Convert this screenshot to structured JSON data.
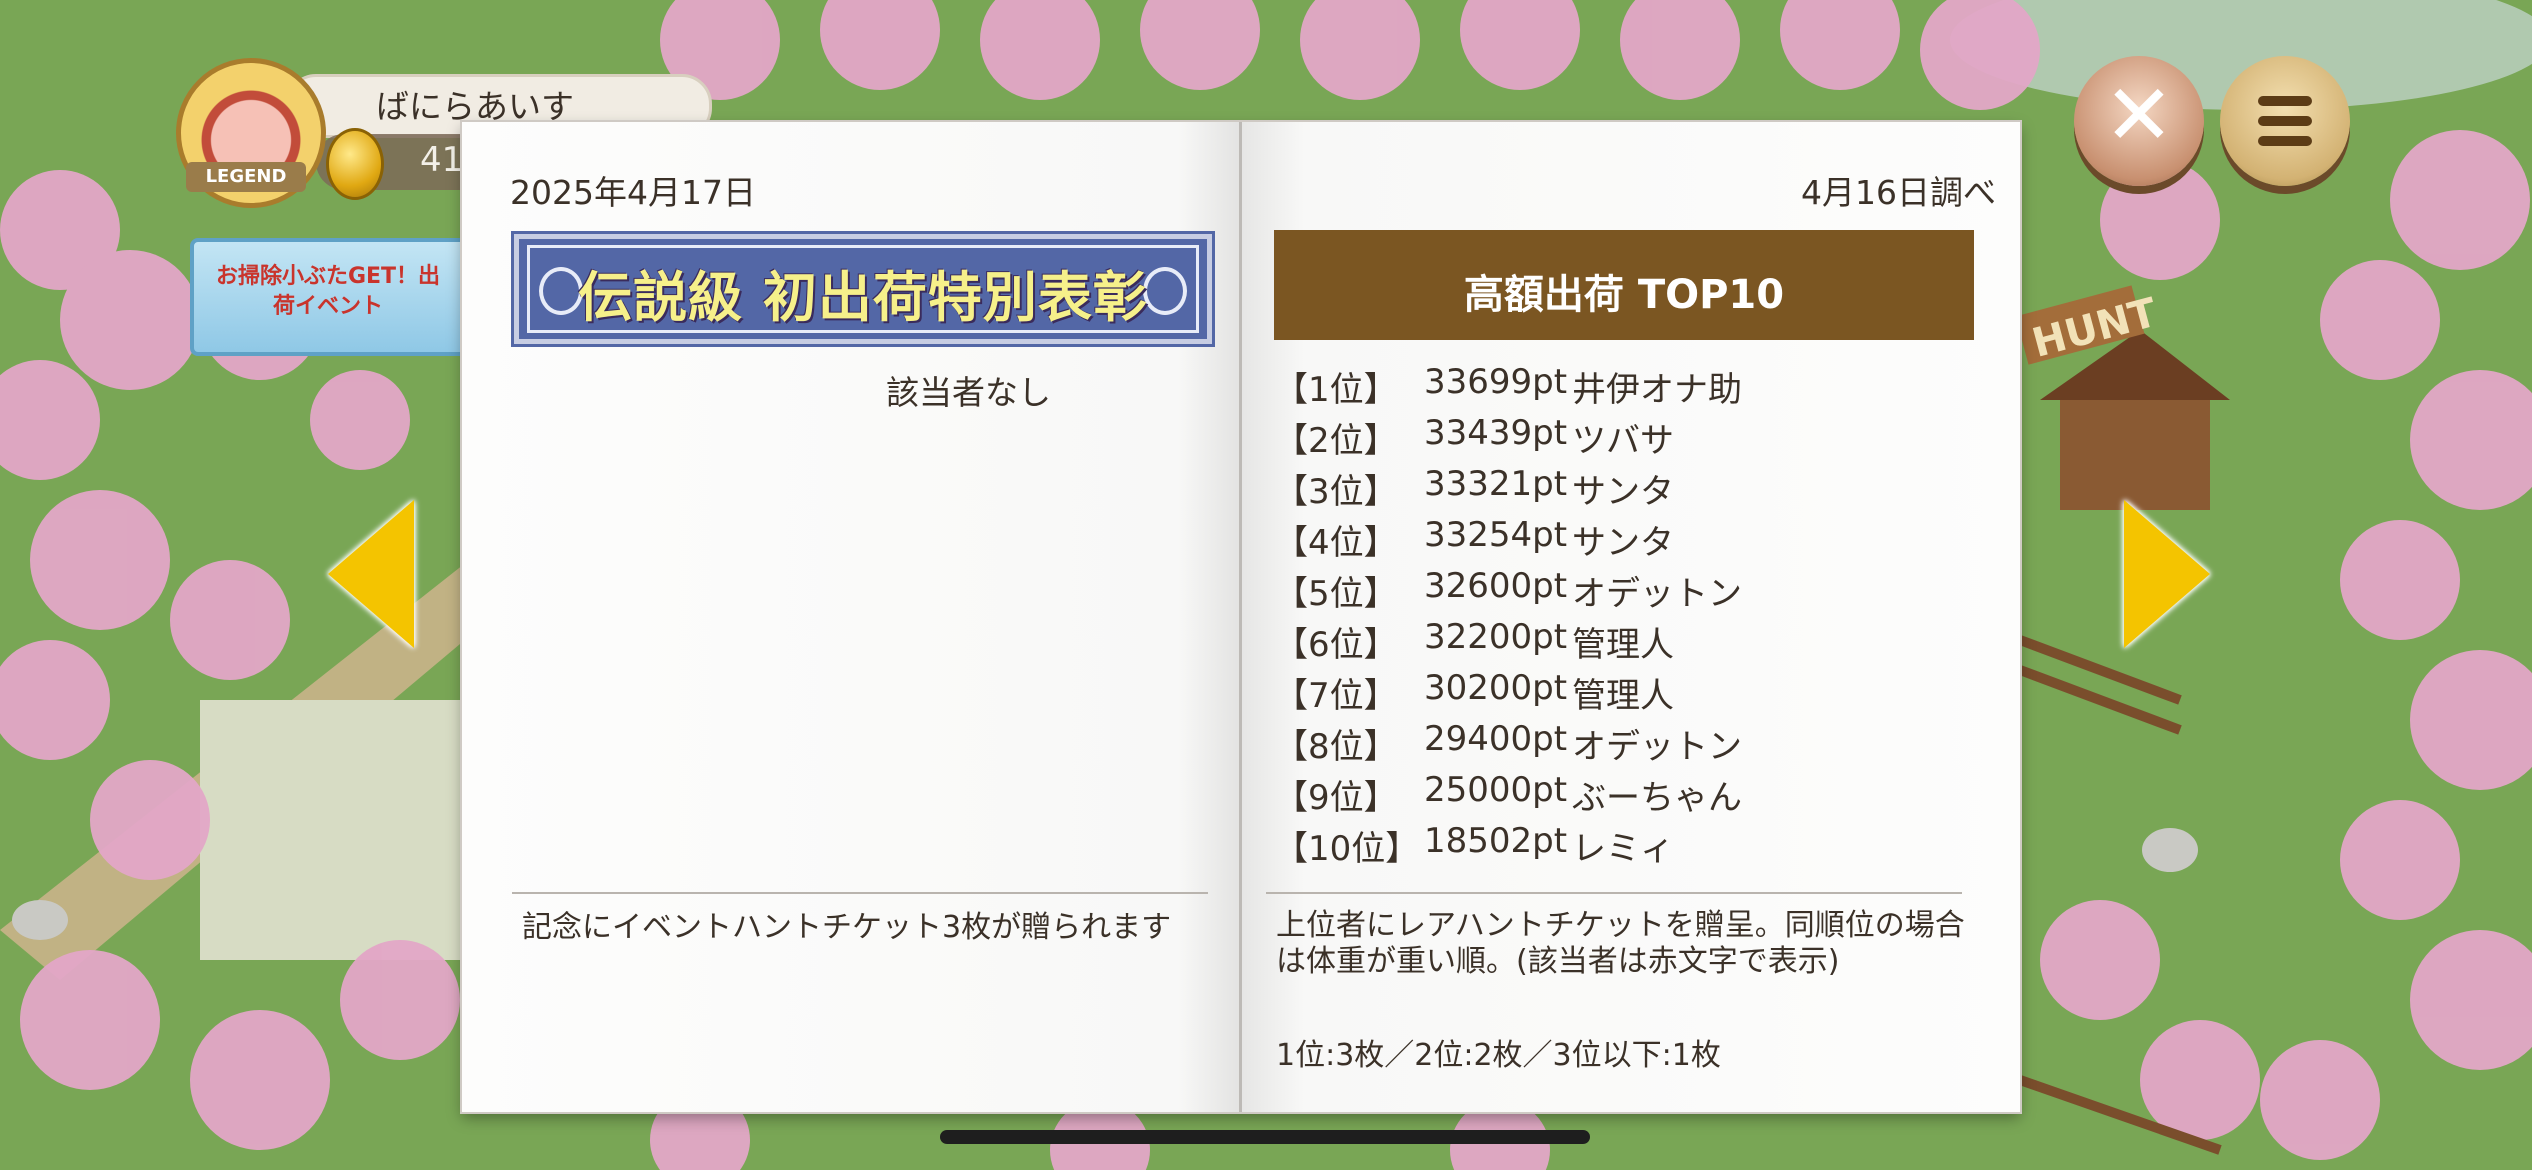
{
  "player": {
    "name": "ばにらあいす",
    "coins": "41",
    "rank_badge": "LEGEND"
  },
  "event_banner": {
    "text": "お掃除小ぶたGET！出荷イベント"
  },
  "controls": {
    "close_glyph": "✕",
    "close_icon": "close-icon",
    "menu_icon": "hamburger-menu-icon",
    "prev_icon": "arrow-left-icon",
    "next_icon": "arrow-right-icon"
  },
  "book": {
    "left_page": {
      "date": "2025年4月17日",
      "award_title": "伝説級 初出荷特別表彰",
      "award_result": "該当者なし",
      "note": "記念にイベントハントチケット3枚が贈られます"
    },
    "right_page": {
      "survey_date": "4月16日調べ",
      "ranking_title": "高額出荷 TOP10",
      "ranking": [
        {
          "position": "【1位】",
          "score": "33699pt",
          "name": "井伊オナ助"
        },
        {
          "position": "【2位】",
          "score": "33439pt",
          "name": "ツバサ"
        },
        {
          "position": "【3位】",
          "score": "33321pt",
          "name": "サンタ"
        },
        {
          "position": "【4位】",
          "score": "33254pt",
          "name": "サンタ"
        },
        {
          "position": "【5位】",
          "score": "32600pt",
          "name": "オデットン"
        },
        {
          "position": "【6位】",
          "score": "32200pt",
          "name": "管理人"
        },
        {
          "position": "【7位】",
          "score": "30200pt",
          "name": "管理人"
        },
        {
          "position": "【8位】",
          "score": "29400pt",
          "name": "オデットン"
        },
        {
          "position": "【9位】",
          "score": "25000pt",
          "name": "ぶーちゃん"
        },
        {
          "position": "【10位】",
          "score": "18502pt",
          "name": "レミィ"
        }
      ],
      "note": "上位者にレアハントチケットを贈呈。同順位の場合は体重が重い順。(該当者は赤文字で表示)",
      "prizes": "1位:3枚／2位:2枚／3位以下:1枚"
    }
  },
  "scene": {
    "sign_text": "HUNT"
  },
  "colors": {
    "ranking_header_bg": "#7b5622",
    "award_bg": "#5367a6",
    "award_text": "#f6f08a",
    "arrow": "#f4c400"
  }
}
